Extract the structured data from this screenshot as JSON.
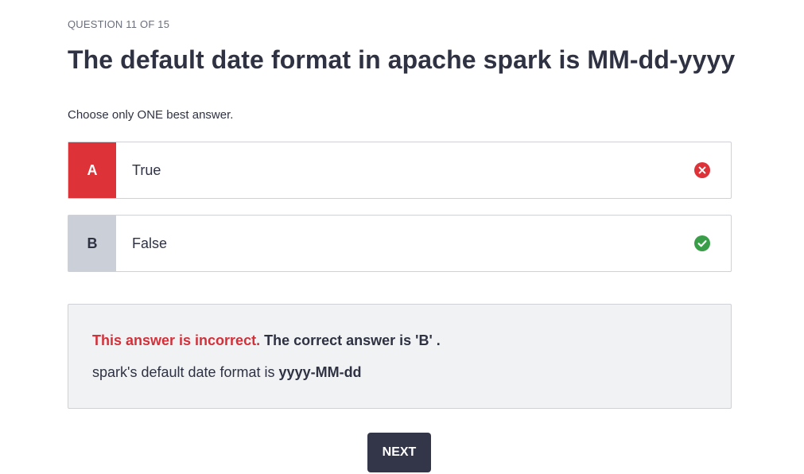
{
  "quiz": {
    "progress": "QUESTION 11 OF 15",
    "question": "The default date format in apache spark is MM-dd-yyyy",
    "instruction": "Choose only ONE best answer."
  },
  "options": [
    {
      "letter": "A",
      "text": "True",
      "status": "incorrect",
      "icon": "x-circle-icon",
      "color": "#dc3238"
    },
    {
      "letter": "B",
      "text": "False",
      "status": "correct",
      "icon": "check-circle-icon",
      "color": "#3a9d48"
    }
  ],
  "feedback": {
    "incorrect_label": "This answer is incorrect.",
    "correct_answer": "The correct answer is 'B' .",
    "explanation_prefix": "spark's default date format is ",
    "explanation_value": "yyyy-MM-dd"
  },
  "actions": {
    "next_label": "NEXT"
  },
  "colors": {
    "error": "#dc3238",
    "success": "#3a9d48",
    "primary_button": "#333648",
    "feedback_bg": "#f1f2f4"
  }
}
